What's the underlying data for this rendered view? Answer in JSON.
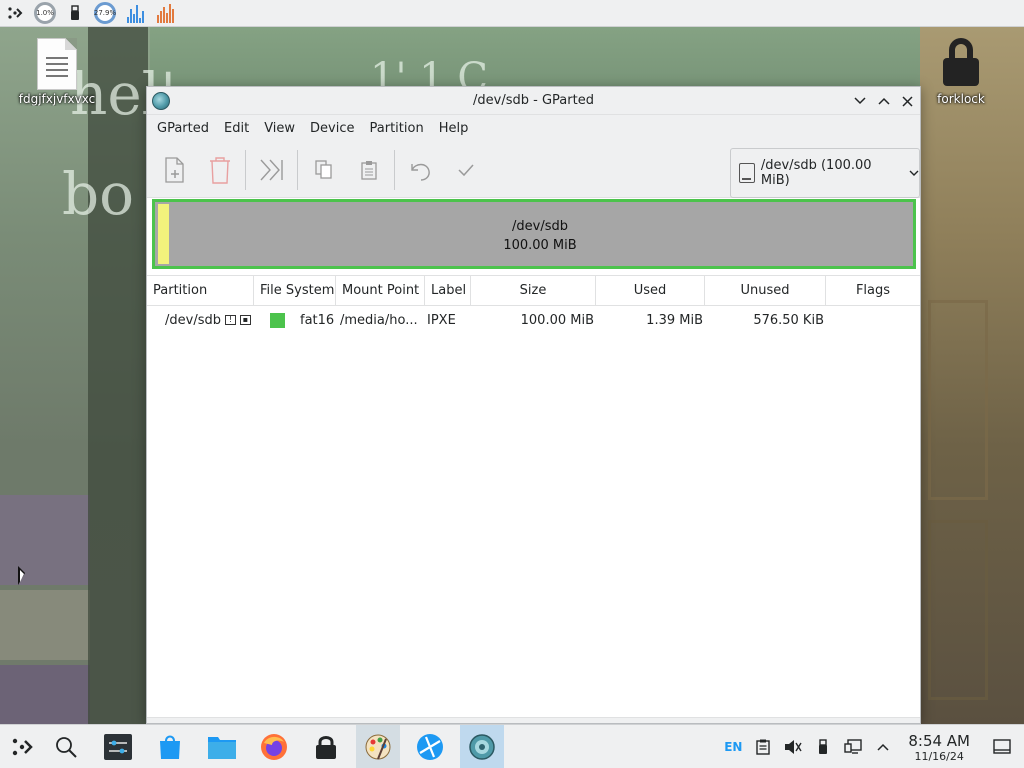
{
  "top_panel": {
    "cpu_text": "1.0%",
    "mem_text": "27.9%"
  },
  "desktop": {
    "icons": [
      {
        "label": "fdgjfxjvfxvxc"
      },
      {
        "label": "forklock"
      }
    ],
    "background_text": [
      "hel'",
      "bo",
      "1' 1 C"
    ]
  },
  "window": {
    "title": "/dev/sdb - GParted",
    "menu": [
      "GParted",
      "Edit",
      "View",
      "Device",
      "Partition",
      "Help"
    ],
    "device_selector": "/dev/sdb (100.00 MiB)",
    "diskmap": {
      "name": "/dev/sdb",
      "size": "100.00 MiB",
      "used_fraction": 0.0139
    },
    "columns": [
      "Partition",
      "File System",
      "Mount Point",
      "Label",
      "Size",
      "Used",
      "Unused",
      "Flags"
    ],
    "rows": [
      {
        "partition": "/dev/sdb",
        "filesystem": "fat16",
        "mount_point": "/media/ho...",
        "label": "IPXE",
        "size": "100.00 MiB",
        "used": "1.39 MiB",
        "unused": "576.50 KiB",
        "flags": ""
      }
    ]
  },
  "taskbar": {
    "lang": "EN",
    "time": "8:54 AM",
    "date": "11/16/24"
  },
  "colors": {
    "fat16": "#4cc34c",
    "selection_border": "#4cc34c",
    "unallocated": "#a6a6a6",
    "used_marker": "#f2f27c"
  }
}
